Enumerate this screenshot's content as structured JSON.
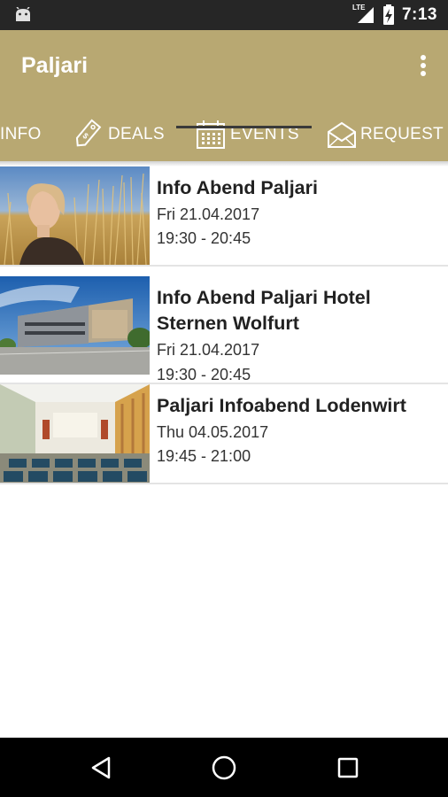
{
  "status_bar": {
    "time": "7:13",
    "network": "LTE",
    "icons": [
      "android-icon",
      "lte-signal-icon",
      "battery-charging-icon"
    ]
  },
  "app_bar": {
    "title": "Paljari",
    "background_color": "#b8a872",
    "menu_icon": "more-vert-icon"
  },
  "tabs": [
    {
      "label": "INFO",
      "icon": null,
      "selected": false
    },
    {
      "label": "DEALS",
      "icon": "price-tag-icon",
      "selected": false
    },
    {
      "label": "EVENTS",
      "icon": "calendar-icon",
      "selected": true
    },
    {
      "label": "REQUEST",
      "icon": "envelope-icon",
      "selected": false
    }
  ],
  "events": [
    {
      "title": "Info Abend Paljari",
      "date": "Fri 21.04.2017",
      "time": "19:30 - 20:45",
      "image": "woman-in-grass-photo"
    },
    {
      "title": "Info Abend Paljari Hotel Sternen Wolfurt",
      "date": "Fri 21.04.2017",
      "time": "19:30 - 20:45",
      "image": "hotel-building-photo"
    },
    {
      "title": "Paljari Infoabend Lodenwirt",
      "date": "Thu 04.05.2017",
      "time": "19:45 - 21:00",
      "image": "conference-room-photo"
    }
  ],
  "nav_bar": {
    "buttons": [
      "back-icon",
      "home-icon",
      "recents-icon"
    ]
  }
}
